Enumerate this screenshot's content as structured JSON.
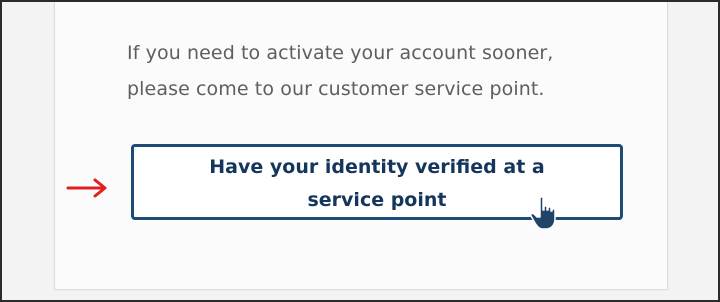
{
  "message": {
    "line1": "If you need to activate your account sooner,",
    "line2": "please come to our customer service point."
  },
  "button": {
    "line1": "Have your identity verified at a",
    "line2": "service point"
  },
  "colors": {
    "button_border": "#1f4b79",
    "button_text": "#15365c",
    "annotation_arrow": "#e02020",
    "hand_cursor": "#1f4468"
  },
  "icons": {
    "annotation": "red-arrow-icon",
    "cursor": "hand-pointer-icon"
  }
}
